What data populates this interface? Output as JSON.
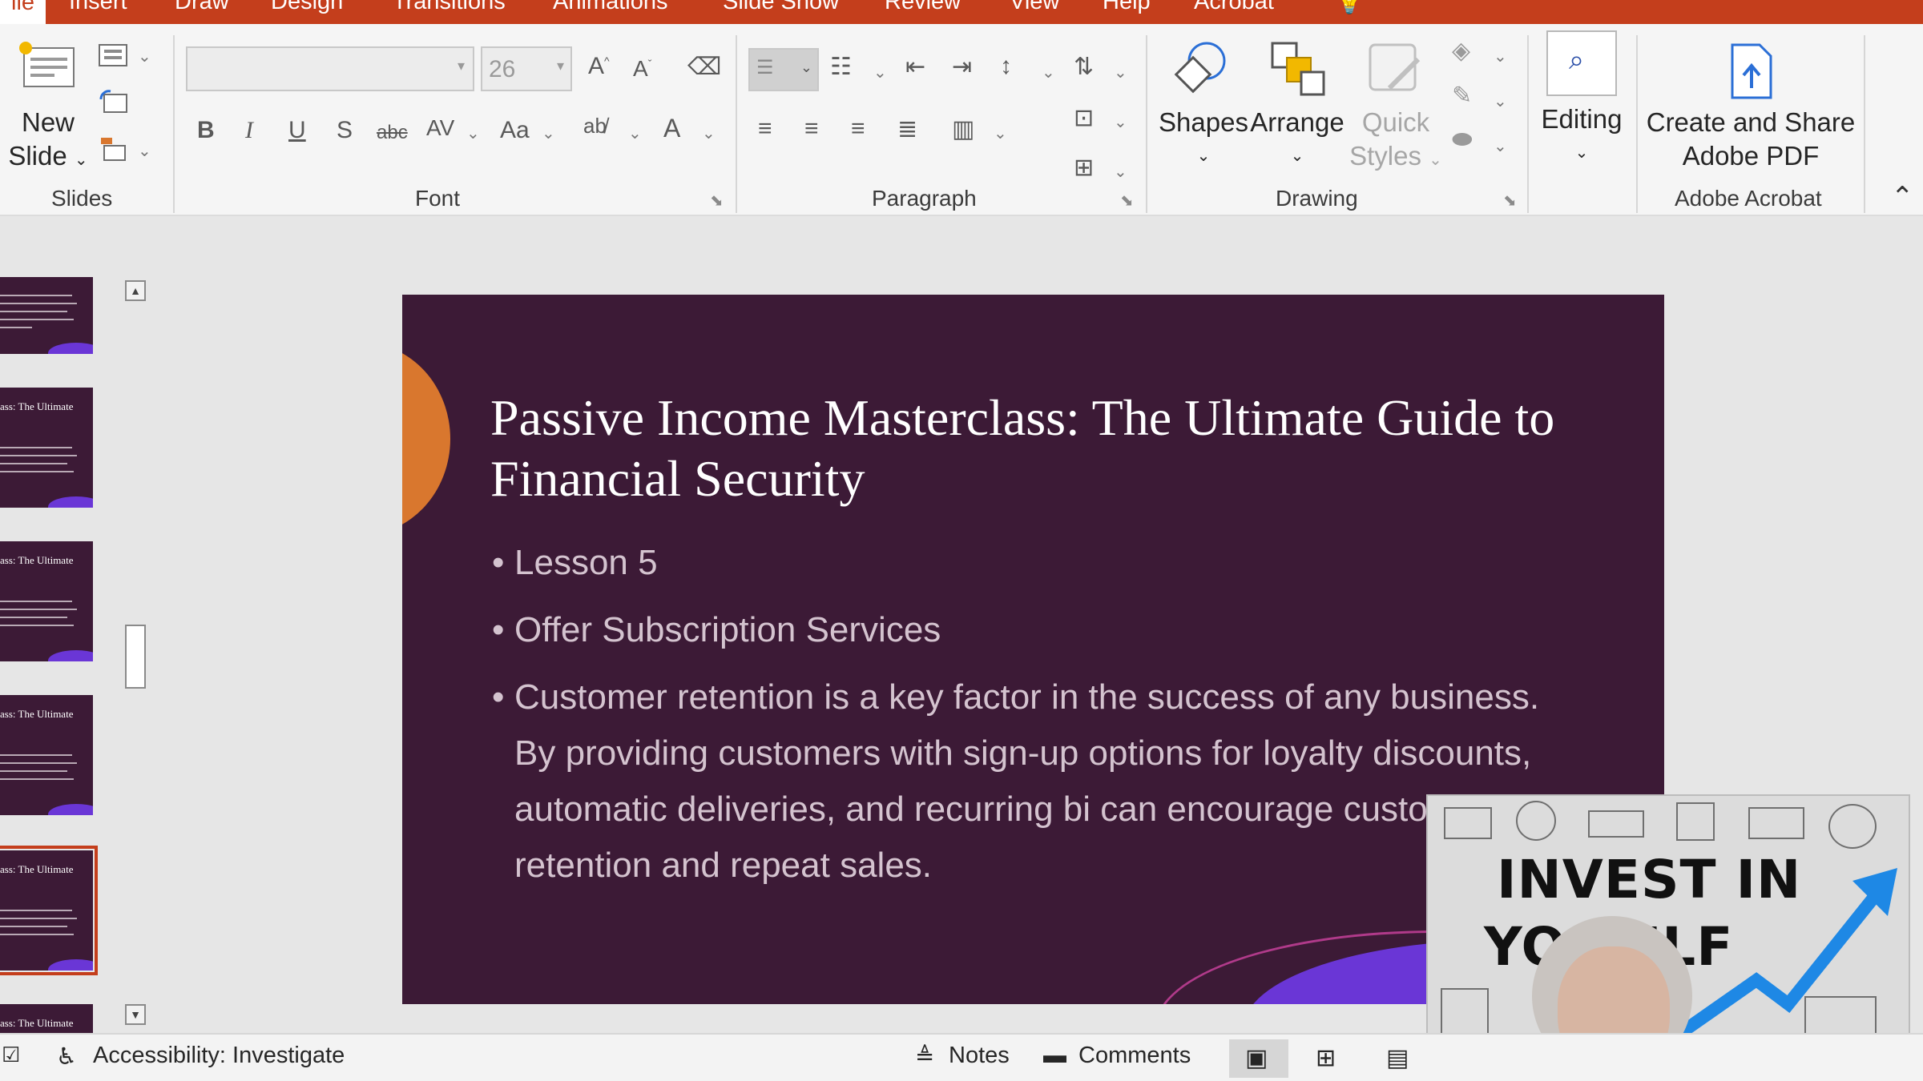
{
  "ribbon_tabs": [
    "ile",
    "Insert",
    "Draw",
    "Design",
    "Transitions",
    "Animations",
    "Slide Show",
    "Review",
    "View",
    "Help",
    "Acrobat"
  ],
  "slides_group": {
    "new_slide_label_1": "New",
    "new_slide_label_2": "Slide",
    "label": "Slides"
  },
  "font_group": {
    "font_name": "",
    "font_size": "26",
    "label": "Font"
  },
  "paragraph_group": {
    "label": "Paragraph"
  },
  "drawing_group": {
    "shapes": "Shapes",
    "arrange": "Arrange",
    "quick_styles_1": "Quick",
    "quick_styles_2": "Styles",
    "label": "Drawing"
  },
  "editing_group": {
    "editing": "Editing"
  },
  "acrobat_group": {
    "create_1": "Create and Share",
    "create_2": "Adobe PDF",
    "label": "Adobe Acrobat"
  },
  "thumbnails": [
    {
      "title": ""
    },
    {
      "title": "ass: The Ultimate"
    },
    {
      "title": "ass: The Ultimate"
    },
    {
      "title": "ass: The Ultimate"
    },
    {
      "title": "ass: The Ultimate",
      "selected": true
    },
    {
      "title": "ass: The Ultimate"
    }
  ],
  "slide": {
    "title": "Passive Income Masterclass:  The Ultimate Guide to Financial Security",
    "bullets": [
      "Lesson 5",
      "Offer Subscription Services",
      "Customer retention is a key factor in the success of any business. By providing customers with sign-up options for loyalty discounts, automatic deliveries, and recurring bi can encourage customer retention and repeat sales."
    ]
  },
  "webcam": {
    "line1": "INVEST IN",
    "line2": "YO    SELF"
  },
  "status_bar": {
    "accessibility": "Accessibility: Investigate",
    "notes": "Notes",
    "comments": "Comments"
  },
  "colors": {
    "accent": "#c43e1c",
    "slide_bg": "#3c1a36",
    "slide_orange": "#d9772e",
    "slide_purple": "#6a36d6"
  }
}
